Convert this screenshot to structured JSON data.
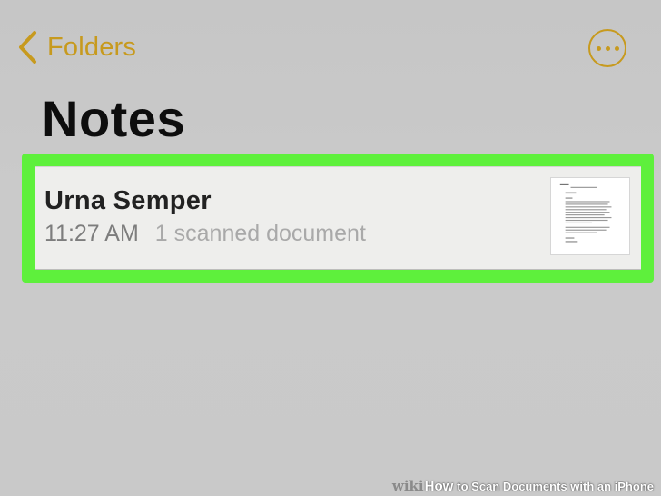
{
  "nav": {
    "back_label": "Folders",
    "back_icon": "chevron-left-icon",
    "more_icon": "ellipsis-circle-icon"
  },
  "page": {
    "title": "Notes"
  },
  "notes": [
    {
      "title": "Urna Semper",
      "time": "11:27 AM",
      "summary": "1 scanned document",
      "thumbnail_icon": "scanned-document-thumbnail"
    }
  ],
  "watermark": {
    "brand": "wiki",
    "how": "How",
    "rest": "to Scan Documents with an iPhone"
  },
  "colors": {
    "accent": "#c79a1e",
    "highlight": "#5ef03c",
    "background": "#c9c9c9",
    "row_background": "#eeeeec"
  }
}
